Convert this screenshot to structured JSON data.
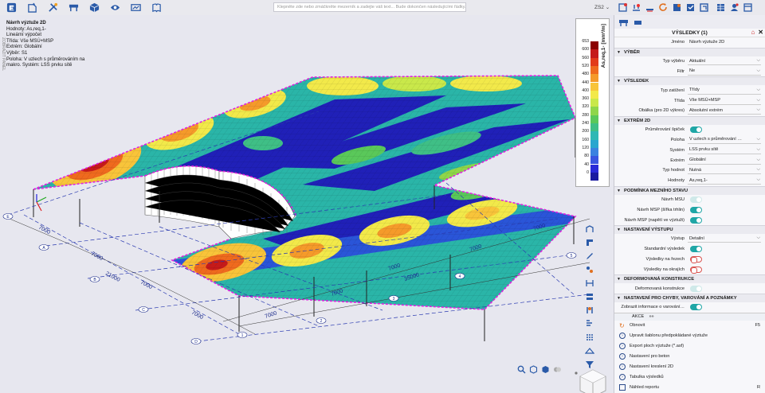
{
  "toolbar": {
    "command_placeholder": "Klepněte zde nebo zmáčkněte mezerník a zadejte váš text... Bude dokončen následujícími řádky.",
    "zs_label": "ZS2",
    "icons": [
      "app-icon",
      "new-icon",
      "tools-icon",
      "structure-icon",
      "view-box-icon",
      "eye-icon",
      "results-icon",
      "report-icon"
    ]
  },
  "info": {
    "title": "Návrh výztuže 2D",
    "lines": [
      "Hodnoty: As,req,1-",
      "Lineární výpočet",
      "Třída: Vše MSÚ+MSP",
      "Extrém: Globální",
      "Výběr: S1",
      "Poloha: V uzlech s průměrováním  na",
      "makro. Systém: LSS prvku sítě"
    ],
    "vertical_label": "ZOBRAZIT PANEL"
  },
  "legend": {
    "label": "As,req,1- [mm²/m]",
    "values": [
      "653",
      "600",
      "560",
      "520",
      "480",
      "440",
      "400",
      "360",
      "320",
      "280",
      "240",
      "200",
      "160",
      "120",
      "80",
      "40",
      "0"
    ],
    "colors": [
      "#8b0000",
      "#c51a1a",
      "#e23a1a",
      "#ef6a1e",
      "#f59a2a",
      "#f8c43a",
      "#f2e94a",
      "#c9e84a",
      "#8fd64a",
      "#5ac85a",
      "#3fbf86",
      "#2fb8b4",
      "#2aa6cf",
      "#3b82e0",
      "#3a55e0",
      "#2a2ad8",
      "#1a1aa0"
    ]
  },
  "model": {
    "dims": [
      "7000",
      "7000",
      "7000",
      "7000",
      "7000",
      "7000",
      "7000",
      "7000",
      "7000",
      "21000",
      "35000"
    ],
    "grid_labels": [
      "A",
      "B",
      "C",
      "D",
      "E",
      "1",
      "2",
      "3",
      "4",
      "5"
    ]
  },
  "panel": {
    "title": "VÝSLEDKY (1)",
    "name_label": "Jméno",
    "name_value": "Návrh výztuže 2D",
    "sections": [
      {
        "title": "VÝBĚR",
        "rows": [
          {
            "label": "Typ výběru",
            "value": "Aktuální"
          },
          {
            "label": "Filtr",
            "value": "Ne"
          }
        ]
      },
      {
        "title": "VÝSLEDEK",
        "rows": [
          {
            "label": "Typ zatížení",
            "value": "Třídy"
          },
          {
            "label": "Třída",
            "value": "Vše MSÚ+MSP"
          },
          {
            "label": "Obálka (pro 2D výkres)",
            "value": "Absolutní extrém"
          }
        ]
      },
      {
        "title": "EXTRÉM 2D",
        "rows": [
          {
            "label": "Průměrování špiček",
            "toggle": "on"
          },
          {
            "label": "Poloha",
            "value": "V uzlech s průměrování …"
          },
          {
            "label": "Systém",
            "value": "LSS prvku sítě"
          },
          {
            "label": "Extrém",
            "value": "Globální"
          },
          {
            "label": "Typ hodnot",
            "value": "Nutná"
          },
          {
            "label": "Hodnoty",
            "value": "As,req,1-"
          }
        ]
      },
      {
        "title": "PODMÍNKA MEZNÍHO STAVU",
        "rows": [
          {
            "label": "Návrh MSÚ",
            "toggle": "dis"
          },
          {
            "label": "Návrh MSP (šířka trhlin)",
            "toggle": "on"
          },
          {
            "label": "Návrh MSP (napětí ve výztuži)",
            "toggle": "on"
          }
        ]
      },
      {
        "title": "NASTAVENÍ VÝSTUPU",
        "rows": [
          {
            "label": "Výstup",
            "value": "Detailní"
          },
          {
            "label": "Standardní výsledek",
            "toggle": "on"
          },
          {
            "label": "Výsledky na řezech",
            "toggle": "off"
          },
          {
            "label": "Výsledky na okrajích",
            "toggle": "off"
          }
        ]
      },
      {
        "title": "DEFORMOVANÁ KONSTRUKCE",
        "rows": [
          {
            "label": "Deformovaná konstrukce",
            "toggle": "dis"
          }
        ]
      },
      {
        "title": "NASTAVENÍ PRO CHYBY, VAROVÁNÍ A POZNÁMKY",
        "rows": [
          {
            "label": "Zobrazit informace o varování…",
            "toggle": "on"
          }
        ]
      }
    ],
    "akce_label": "AKCE",
    "actions": [
      {
        "label": "Obnovit",
        "key": "F5",
        "icon": "refresh-icon"
      },
      {
        "label": "Upravit šablonu předpokládané výztuže",
        "key": "",
        "icon": "action-icon"
      },
      {
        "label": "Export ploch výztuže (*.asf)",
        "key": "",
        "icon": "action-icon"
      },
      {
        "label": "Nastavení pro beton",
        "key": "",
        "icon": "action-icon"
      },
      {
        "label": "Nastavení kreslení 2D",
        "key": "",
        "icon": "action-icon"
      },
      {
        "label": "Tabulka výsledků",
        "key": "",
        "icon": "action-icon"
      },
      {
        "label": "Náhled reportu",
        "key": "R",
        "icon": "report-icon"
      }
    ]
  }
}
